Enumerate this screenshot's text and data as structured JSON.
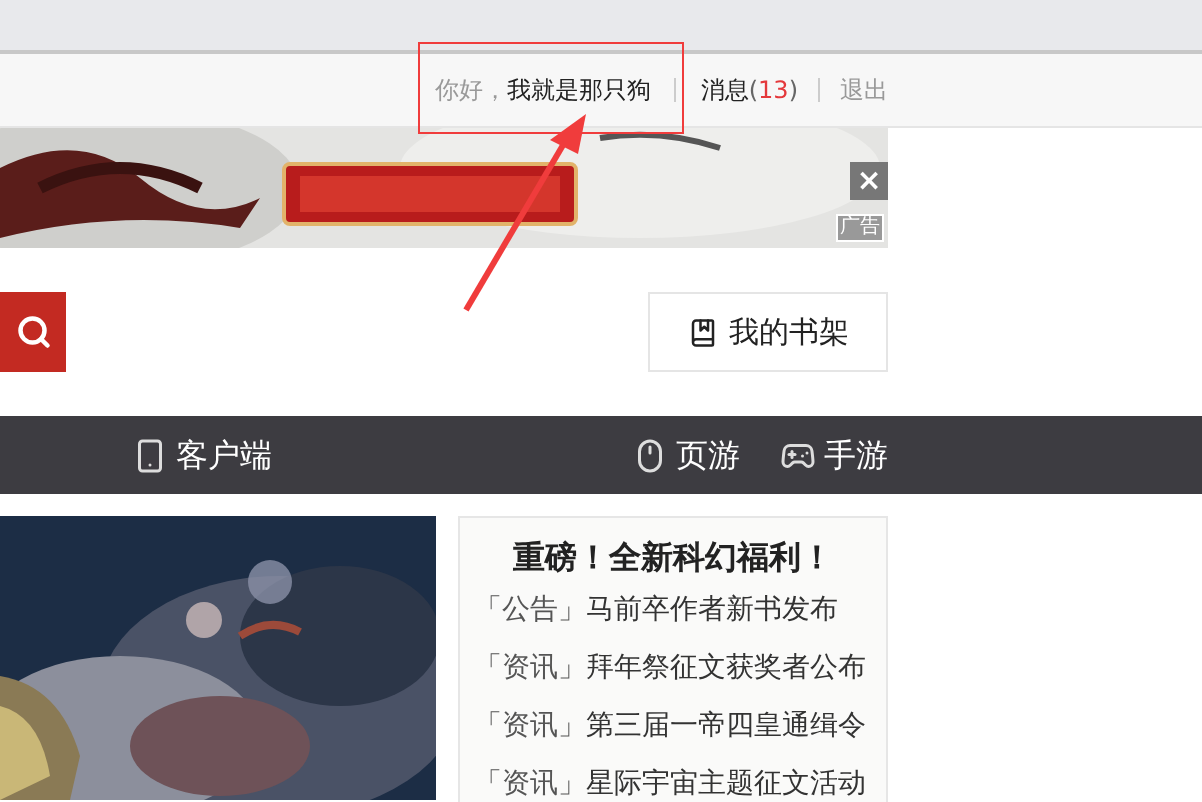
{
  "user_bar": {
    "greeting": "你好，",
    "username": "我就是那只狗",
    "messages_label": "消息",
    "count_open": "(",
    "messages_count": "13",
    "count_close": ")",
    "logout": "退出"
  },
  "ad": {
    "close_label": "×",
    "ad_label": "广告"
  },
  "bookshelf": {
    "label": "我的书架"
  },
  "nav": [
    {
      "label": "客户端",
      "kind": "phone"
    },
    {
      "label": "页游",
      "kind": "mouse"
    },
    {
      "label": "手游",
      "kind": "gamepad"
    }
  ],
  "news": {
    "title": "重磅！全新科幻福利！",
    "items": [
      {
        "tag": "「公告」",
        "text": "马前卒作者新书发布"
      },
      {
        "tag": "「资讯」",
        "text": "拜年祭征文获奖者公布"
      },
      {
        "tag": "「资讯」",
        "text": "第三届一帝四皇通缉令"
      },
      {
        "tag": "「资讯」",
        "text": "星际宇宙主题征文活动"
      }
    ]
  }
}
